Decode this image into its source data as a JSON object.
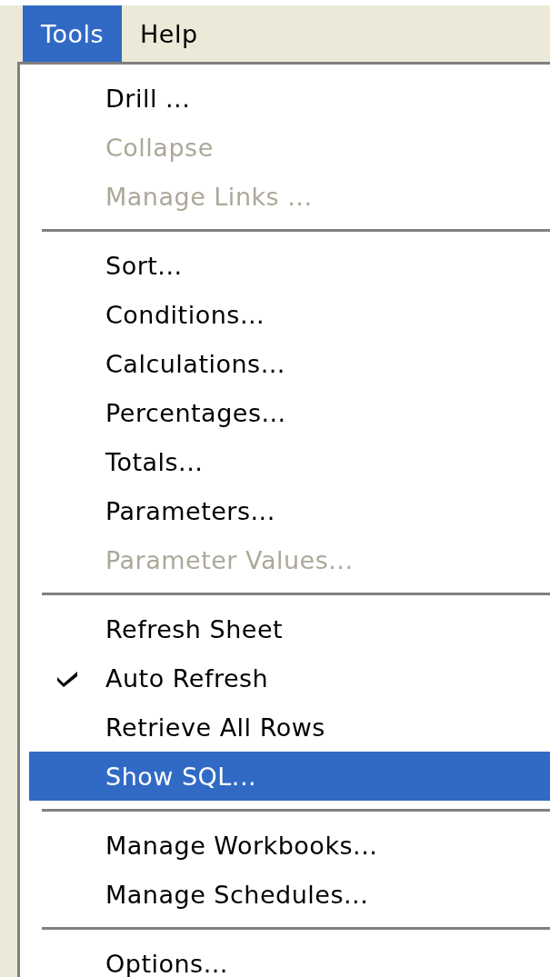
{
  "menu_bar": [
    {
      "label": "Tools",
      "selected": true
    },
    {
      "label": "Help",
      "selected": false
    }
  ],
  "menu": {
    "groups": [
      [
        {
          "label": "Drill ...",
          "disabled": false,
          "checked": false,
          "selected": false
        },
        {
          "label": "Collapse",
          "disabled": true,
          "checked": false,
          "selected": false
        },
        {
          "label": "Manage Links ...",
          "disabled": true,
          "checked": false,
          "selected": false
        }
      ],
      [
        {
          "label": "Sort...",
          "disabled": false,
          "checked": false,
          "selected": false
        },
        {
          "label": "Conditions...",
          "disabled": false,
          "checked": false,
          "selected": false
        },
        {
          "label": "Calculations...",
          "disabled": false,
          "checked": false,
          "selected": false
        },
        {
          "label": "Percentages...",
          "disabled": false,
          "checked": false,
          "selected": false
        },
        {
          "label": "Totals...",
          "disabled": false,
          "checked": false,
          "selected": false
        },
        {
          "label": "Parameters...",
          "disabled": false,
          "checked": false,
          "selected": false
        },
        {
          "label": "Parameter Values...",
          "disabled": true,
          "checked": false,
          "selected": false
        }
      ],
      [
        {
          "label": "Refresh Sheet",
          "disabled": false,
          "checked": false,
          "selected": false
        },
        {
          "label": "Auto Refresh",
          "disabled": false,
          "checked": true,
          "selected": false
        },
        {
          "label": "Retrieve All Rows",
          "disabled": false,
          "checked": false,
          "selected": false
        },
        {
          "label": "Show SQL...",
          "disabled": false,
          "checked": false,
          "selected": true
        }
      ],
      [
        {
          "label": "Manage Workbooks...",
          "disabled": false,
          "checked": false,
          "selected": false
        },
        {
          "label": "Manage Schedules...",
          "disabled": false,
          "checked": false,
          "selected": false
        }
      ],
      [
        {
          "label": "Options...",
          "disabled": false,
          "checked": false,
          "selected": false
        }
      ]
    ]
  }
}
